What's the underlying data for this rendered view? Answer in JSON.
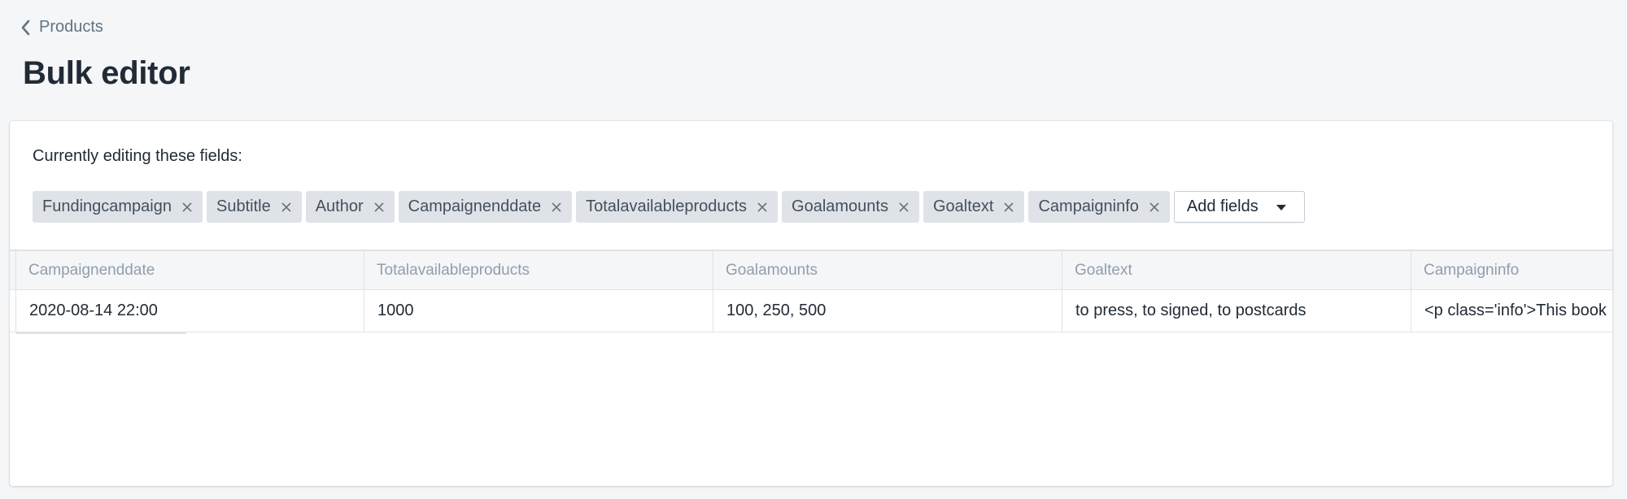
{
  "breadcrumb": {
    "label": "Products"
  },
  "page": {
    "title": "Bulk editor"
  },
  "editor": {
    "label": "Currently editing these fields:",
    "chips": [
      "Fundingcampaign",
      "Subtitle",
      "Author",
      "Campaignenddate",
      "Totalavailableproducts",
      "Goalamounts",
      "Goaltext",
      "Campaigninfo"
    ],
    "add_fields_label": "Add fields"
  },
  "grid": {
    "columns": [
      "Campaignenddate",
      "Totalavailableproducts",
      "Goalamounts",
      "Goaltext",
      "Campaigninfo"
    ],
    "rows": [
      [
        "2020-08-14 22:00",
        "1000",
        "100, 250, 500",
        "to press, to signed, to postcards",
        "<p class='info'>This book"
      ]
    ]
  },
  "icons": {
    "back": "chevron-left-icon",
    "remove": "close-icon",
    "dropdown": "caret-down-icon"
  }
}
